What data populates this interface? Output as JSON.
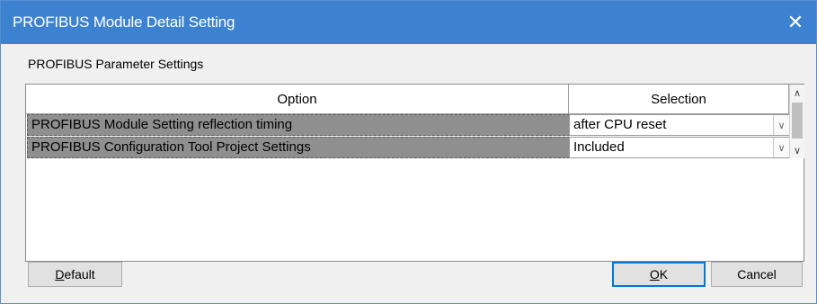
{
  "window": {
    "title": "PROFIBUS Module Detail Setting",
    "close_glyph": "✕"
  },
  "group": {
    "label": "PROFIBUS Parameter Settings"
  },
  "grid": {
    "columns": [
      "Option",
      "Selection"
    ],
    "rows": [
      {
        "option": "PROFIBUS Module Setting reflection timing",
        "selection": "after CPU reset"
      },
      {
        "option": "PROFIBUS Configuration Tool Project Settings",
        "selection": "Included"
      }
    ]
  },
  "buttons": {
    "default_first": "D",
    "default_rest": "efault",
    "ok_first": "O",
    "ok_rest": "K",
    "cancel": "Cancel"
  },
  "icons": {
    "dropdown": "chevron-down-icon",
    "scroll_up": "chevron-up-icon",
    "scroll_down": "chevron-down-icon",
    "close": "close-icon"
  },
  "colors": {
    "titlebar": "#3c82d1",
    "row_highlight": "#8f8f8f",
    "ok_border": "#0078d7"
  }
}
